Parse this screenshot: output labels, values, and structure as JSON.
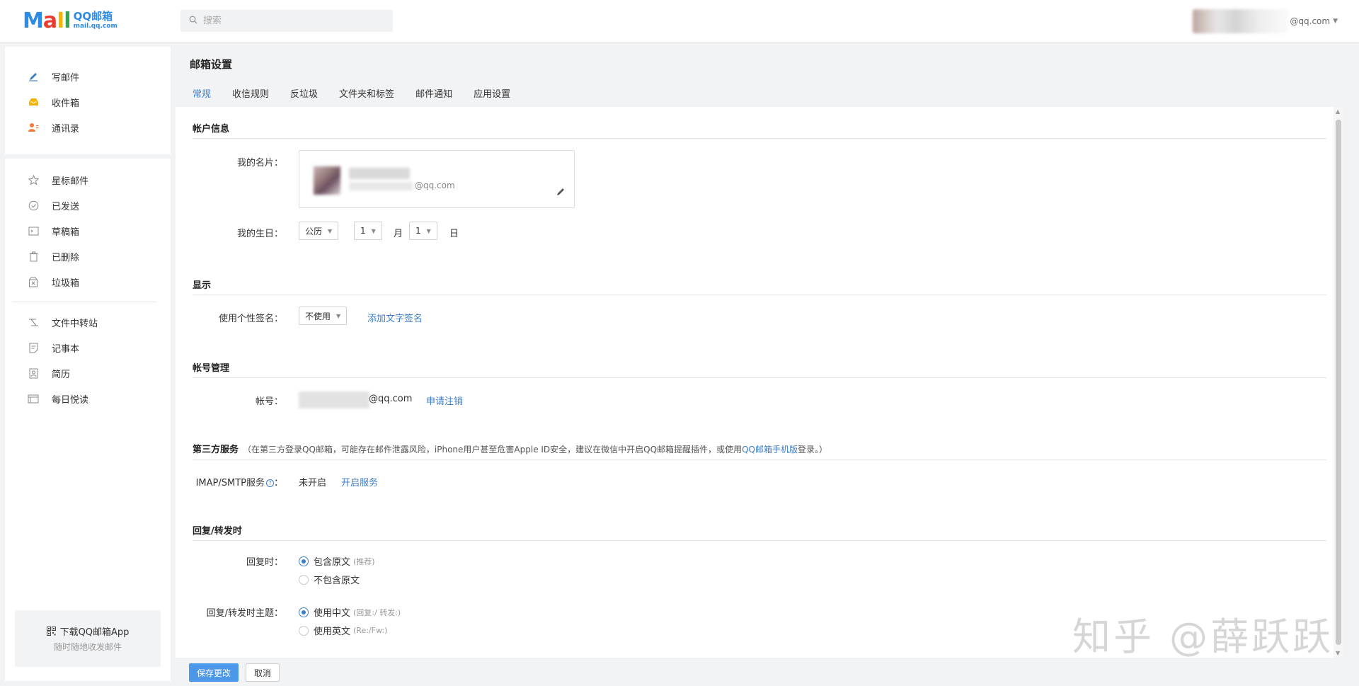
{
  "header": {
    "logo_mail": "MaIl",
    "logo_main": "QQ邮箱",
    "logo_sub": "mail.qq.com",
    "search_placeholder": "搜索",
    "user_email_suffix": "@qq.com"
  },
  "sidebar": {
    "primary": [
      {
        "label": "写邮件",
        "icon": "pencil-icon"
      },
      {
        "label": "收件箱",
        "icon": "inbox-icon"
      },
      {
        "label": "通讯录",
        "icon": "contacts-icon"
      }
    ],
    "folders": [
      {
        "label": "星标邮件",
        "icon": "star-icon"
      },
      {
        "label": "已发送",
        "icon": "sent-check-icon"
      },
      {
        "label": "草稿箱",
        "icon": "draft-icon"
      },
      {
        "label": "已删除",
        "icon": "trash-icon"
      },
      {
        "label": "垃圾箱",
        "icon": "junk-icon"
      }
    ],
    "tools": [
      {
        "label": "文件中转站",
        "icon": "file-transfer-icon"
      },
      {
        "label": "记事本",
        "icon": "notepad-icon"
      },
      {
        "label": "简历",
        "icon": "resume-icon"
      },
      {
        "label": "每日悦读",
        "icon": "reading-icon"
      }
    ],
    "app_promo": {
      "title": "下载QQ邮箱App",
      "subtitle": "随时随地收发邮件"
    }
  },
  "main": {
    "title": "邮箱设置",
    "tabs": [
      "常规",
      "收信规则",
      "反垃圾",
      "文件夹和标签",
      "邮件通知",
      "应用设置"
    ],
    "active_tab": "常规",
    "account_info": {
      "section": "帐户信息",
      "card_label": "我的名片：",
      "card_email_suffix": "@qq.com",
      "birthday_label": "我的生日：",
      "calendar_value": "公历",
      "month_value": "1",
      "month_unit": "月",
      "day_value": "1",
      "day_unit": "日"
    },
    "display": {
      "section": "显示",
      "signature_label": "使用个性签名：",
      "signature_value": "不使用",
      "add_signature": "添加文字签名"
    },
    "account": {
      "section": "帐号管理",
      "account_label": "帐号：",
      "account_suffix": "@qq.com",
      "cancel_link": "申请注销"
    },
    "third_party": {
      "section": "第三方服务",
      "note_prefix": "（在第三方登录QQ邮箱，可能存在邮件泄露风险，iPhone用户甚至危害Apple ID安全，建议在微信中开启QQ邮箱提醒插件，或使用",
      "note_link": "QQ邮箱手机版",
      "note_suffix": "登录。）",
      "imap_label": "IMAP/SMTP服务",
      "imap_colon": "：",
      "imap_status": "未开启",
      "imap_action": "开启服务"
    },
    "reply_forward": {
      "section": "回复/转发时",
      "reply_label": "回复时：",
      "reply_options": [
        {
          "label": "包含原文",
          "hint": "(推荐)",
          "checked": true
        },
        {
          "label": "不包含原文",
          "hint": "",
          "checked": false
        }
      ],
      "subject_label": "回复/转发时主题：",
      "subject_options": [
        {
          "label": "使用中文",
          "hint": "(回复:/ 转发:)",
          "checked": true
        },
        {
          "label": "使用英文",
          "hint": "(Re:/Fw:)",
          "checked": false
        }
      ]
    },
    "buttons": {
      "save": "保存更改",
      "cancel": "取消"
    }
  },
  "watermark": "知乎 @薛跃跃",
  "colors": {
    "accent": "#3d7ec7",
    "primary_button": "#4c97e8"
  }
}
